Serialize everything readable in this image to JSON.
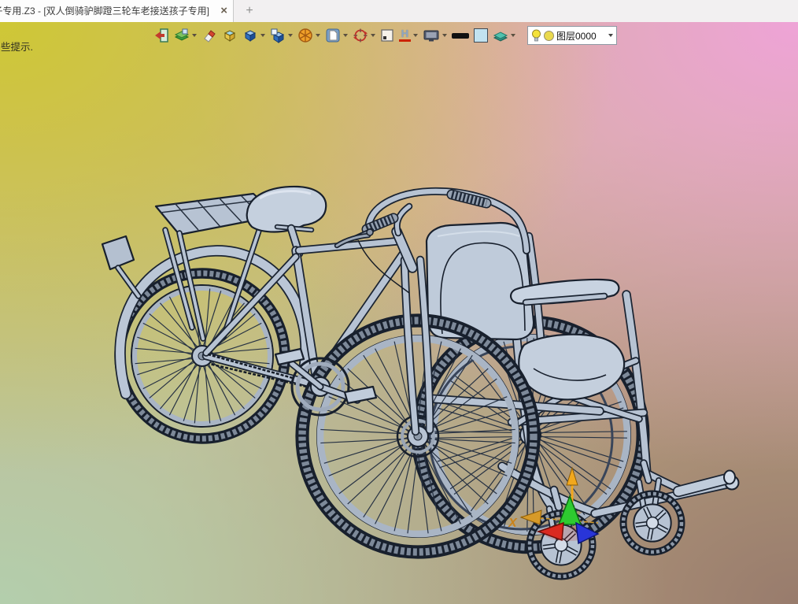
{
  "tab_bar": {
    "active_tab": {
      "title": "子专用.Z3 - [双人倒骑驴脚蹬三轮车老接送孩子专用]",
      "close_label": "×"
    },
    "new_tab_label": "+"
  },
  "status_text": "些提示.",
  "toolbar": {
    "buttons": [
      {
        "name": "exit",
        "dropdown": false
      },
      {
        "name": "layer-manager",
        "dropdown": true
      },
      {
        "name": "eraser",
        "dropdown": false
      },
      {
        "name": "isometric-box",
        "dropdown": false
      },
      {
        "name": "shaded-cube",
        "dropdown": true
      },
      {
        "name": "cube-window",
        "dropdown": true
      },
      {
        "name": "view-wheel",
        "dropdown": true
      },
      {
        "name": "document-frame",
        "dropdown": true
      },
      {
        "name": "rotate-view",
        "dropdown": true
      },
      {
        "name": "frame-dot",
        "dropdown": false
      },
      {
        "name": "hatch",
        "dropdown": true,
        "glyph": "H"
      },
      {
        "name": "monitor",
        "dropdown": true
      },
      {
        "name": "line-width",
        "dropdown": false
      },
      {
        "name": "color-swatch",
        "dropdown": false
      },
      {
        "name": "layers-flat",
        "dropdown": true
      }
    ],
    "layer_combo": {
      "value": "图层0000"
    }
  },
  "viewport": {
    "description": "3D CAD shaded model: pedal tricycle (rear half of bicycle) joined to a wheelchair",
    "triad": {
      "x_label": "X"
    },
    "background_corners": {
      "top_left": "#cfc832",
      "top_right": "#efa3da",
      "bottom_left": "#b2cfae",
      "bottom_right": "#96796b"
    },
    "model_fill": "#b7c3d3",
    "model_edge": "#18202d"
  }
}
